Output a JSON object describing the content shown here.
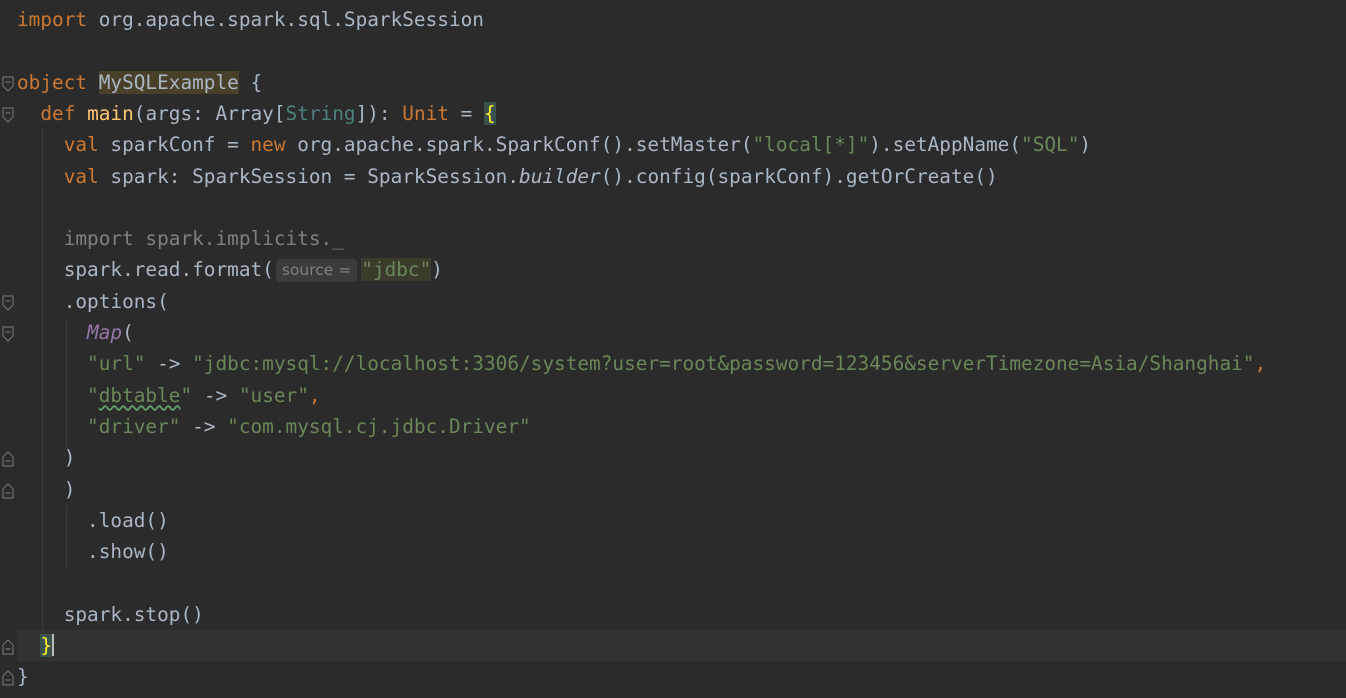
{
  "editor": {
    "language": "scala",
    "fold_icon": "fold-marker-icon",
    "lines": [
      {
        "indent": "",
        "tokens": [
          {
            "t": "import ",
            "c": "kw"
          },
          {
            "t": "org.apache.spark.sql.SparkSession",
            "c": ""
          }
        ]
      },
      {
        "indent": "",
        "tokens": []
      },
      {
        "indent": "",
        "tokens": [
          {
            "t": "object ",
            "c": "kw"
          },
          {
            "t": "MySQLExample",
            "c": "hl-obj"
          },
          {
            "t": " {",
            "c": ""
          }
        ]
      },
      {
        "indent": "  ",
        "tokens": [
          {
            "t": "def ",
            "c": "kw"
          },
          {
            "t": "main",
            "c": "fn"
          },
          {
            "t": "(args: Array[",
            "c": ""
          },
          {
            "t": "String",
            "c": "tp"
          },
          {
            "t": "]): ",
            "c": ""
          },
          {
            "t": "Unit",
            "c": "kw"
          },
          {
            "t": " = ",
            "c": ""
          },
          {
            "t": "{",
            "c": "brace-match"
          }
        ]
      },
      {
        "indent": "    ",
        "tokens": [
          {
            "t": "val ",
            "c": "kw"
          },
          {
            "t": "sparkConf = ",
            "c": ""
          },
          {
            "t": "new ",
            "c": "kw"
          },
          {
            "t": "org.apache.spark.SparkConf().setMaster(",
            "c": ""
          },
          {
            "t": "\"local[*]\"",
            "c": "str"
          },
          {
            "t": ").setAppName(",
            "c": ""
          },
          {
            "t": "\"SQL\"",
            "c": "str"
          },
          {
            "t": ")",
            "c": ""
          }
        ]
      },
      {
        "indent": "    ",
        "tokens": [
          {
            "t": "val ",
            "c": "kw"
          },
          {
            "t": "spark: SparkSession = SparkSession.",
            "c": ""
          },
          {
            "t": "builder",
            "c": "it"
          },
          {
            "t": "().config(sparkConf).getOrCreate()",
            "c": ""
          }
        ]
      },
      {
        "indent": "",
        "tokens": []
      },
      {
        "indent": "    ",
        "tokens": [
          {
            "t": "import spark.implicits._",
            "c": "unused"
          }
        ]
      },
      {
        "indent": "    ",
        "tokens": [
          {
            "t": "spark.read.format(",
            "c": ""
          },
          {
            "t": "source =",
            "c": "inlay"
          },
          {
            "t": "\"jdbc\"",
            "c": "str hl-str"
          },
          {
            "t": ")",
            "c": ""
          }
        ]
      },
      {
        "indent": "    ",
        "tokens": [
          {
            "t": ".options(",
            "c": ""
          }
        ]
      },
      {
        "indent": "      ",
        "tokens": [
          {
            "t": "Map",
            "c": "mapfn"
          },
          {
            "t": "(",
            "c": ""
          }
        ]
      },
      {
        "indent": "      ",
        "tokens": [
          {
            "t": "\"url\"",
            "c": "str"
          },
          {
            "t": " -> ",
            "c": ""
          },
          {
            "t": "\"jdbc:mysql://localhost:3306/system?user=root&password=123456&serverTimezone=Asia/Shanghai\"",
            "c": "str"
          },
          {
            "t": ",",
            "c": "kw"
          }
        ]
      },
      {
        "indent": "      ",
        "tokens": [
          {
            "t": "\"",
            "c": "str"
          },
          {
            "t": "dbtable",
            "c": "str typo"
          },
          {
            "t": "\"",
            "c": "str"
          },
          {
            "t": " -> ",
            "c": ""
          },
          {
            "t": "\"user\"",
            "c": "str"
          },
          {
            "t": ",",
            "c": "kw"
          }
        ]
      },
      {
        "indent": "      ",
        "tokens": [
          {
            "t": "\"driver\"",
            "c": "str"
          },
          {
            "t": " -> ",
            "c": ""
          },
          {
            "t": "\"com.mysql.cj.jdbc.Driver\"",
            "c": "str"
          }
        ]
      },
      {
        "indent": "    ",
        "tokens": [
          {
            "t": ")",
            "c": ""
          }
        ]
      },
      {
        "indent": "    ",
        "tokens": [
          {
            "t": ")",
            "c": ""
          }
        ]
      },
      {
        "indent": "      ",
        "tokens": [
          {
            "t": ".load()",
            "c": ""
          }
        ]
      },
      {
        "indent": "      ",
        "tokens": [
          {
            "t": ".show()",
            "c": ""
          }
        ]
      },
      {
        "indent": "",
        "tokens": []
      },
      {
        "indent": "    ",
        "tokens": [
          {
            "t": "spark.stop()",
            "c": ""
          }
        ]
      },
      {
        "indent": "  ",
        "current": true,
        "tokens": [
          {
            "t": "}",
            "c": "brace-match"
          },
          {
            "t": "",
            "c": "caret"
          }
        ]
      },
      {
        "indent": "",
        "tokens": [
          {
            "t": "}",
            "c": ""
          }
        ]
      }
    ],
    "fold_markers": [
      {
        "line": 2,
        "kind": "open"
      },
      {
        "line": 3,
        "kind": "open"
      },
      {
        "line": 9,
        "kind": "open"
      },
      {
        "line": 10,
        "kind": "open"
      },
      {
        "line": 14,
        "kind": "close"
      },
      {
        "line": 15,
        "kind": "close"
      },
      {
        "line": 20,
        "kind": "close"
      },
      {
        "line": 21,
        "kind": "close"
      }
    ]
  }
}
